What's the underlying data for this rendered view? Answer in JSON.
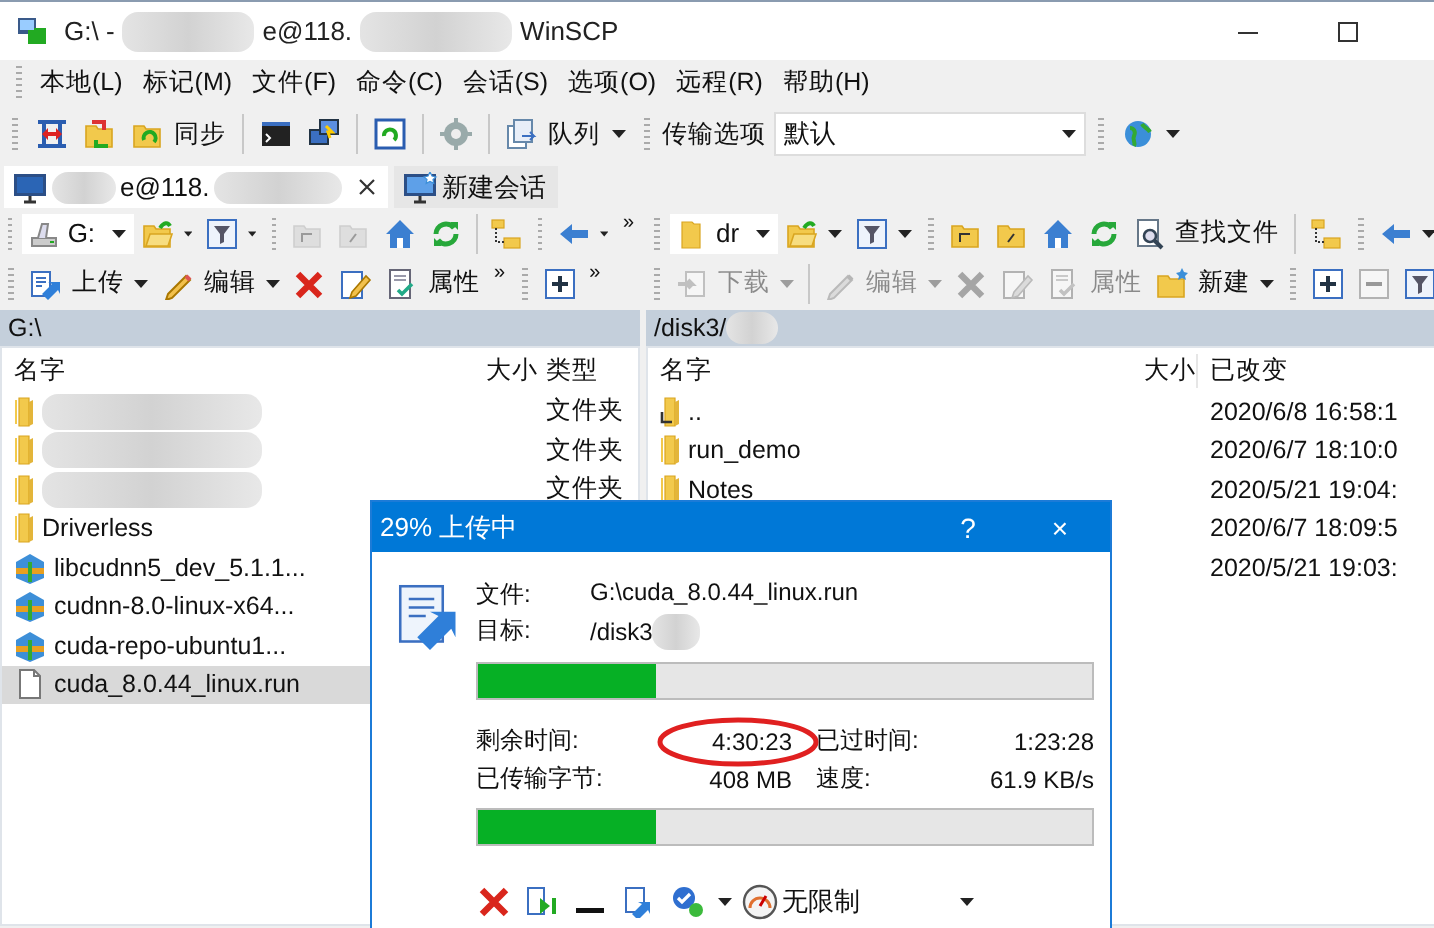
{
  "window": {
    "title_prefix": "G:\\ -",
    "title_host": "e@118.",
    "title_suffix": "WinSCP"
  },
  "menu": [
    {
      "label": "本地(L)"
    },
    {
      "label": "标记(M)"
    },
    {
      "label": "文件(F)"
    },
    {
      "label": "命令(C)"
    },
    {
      "label": "会话(S)"
    },
    {
      "label": "选项(O)"
    },
    {
      "label": "远程(R)"
    },
    {
      "label": "帮助(H)"
    }
  ],
  "main_toolbar": [
    {
      "kind": "grip"
    },
    {
      "kind": "compare"
    },
    {
      "kind": "sync-folders"
    },
    {
      "kind": "sync",
      "label": "同步"
    },
    {
      "kind": "sep"
    },
    {
      "kind": "terminal"
    },
    {
      "kind": "putty"
    },
    {
      "kind": "sep"
    },
    {
      "kind": "panel-refresh"
    },
    {
      "kind": "sep"
    },
    {
      "kind": "gear"
    },
    {
      "kind": "sep"
    },
    {
      "kind": "queue",
      "label": "队列",
      "dropdown": true
    },
    {
      "kind": "grip"
    },
    {
      "kind": "text",
      "label": "传输选项"
    },
    {
      "kind": "combo",
      "label": "默认"
    },
    {
      "kind": "grip"
    },
    {
      "kind": "globe",
      "dropdown": true
    }
  ],
  "session_tabs": [
    {
      "label": "e@118.",
      "selected": true
    },
    {
      "label": "新建会话",
      "selected": false
    }
  ],
  "panels": [
    {
      "toolbar_top": [
        {
          "kind": "grip"
        },
        {
          "kind": "drive-combo",
          "label": "G:"
        },
        {
          "kind": "folder-open",
          "dropdown": true
        },
        {
          "kind": "filter",
          "dropdown": true
        },
        {
          "kind": "grip"
        },
        {
          "kind": "parent-dir",
          "disabled": true
        },
        {
          "kind": "root-dir",
          "disabled": true
        },
        {
          "kind": "home"
        },
        {
          "kind": "refresh"
        },
        {
          "kind": "sep"
        },
        {
          "kind": "tree"
        },
        {
          "kind": "grip"
        },
        {
          "kind": "back",
          "dropdown": true
        },
        {
          "kind": "overflow",
          "label": "»"
        }
      ],
      "toolbar_bottom": [
        {
          "kind": "grip"
        },
        {
          "kind": "upload",
          "label": "上传",
          "dropdown": true,
          "disabled": false
        },
        {
          "kind": "edit",
          "label": "编辑",
          "dropdown": true,
          "disabled": false
        },
        {
          "kind": "delete",
          "disabled": false
        },
        {
          "kind": "rename",
          "disabled": false
        },
        {
          "kind": "properties",
          "label": "属性",
          "disabled": false
        },
        {
          "kind": "overflow",
          "label": "»"
        },
        {
          "kind": "grip"
        },
        {
          "kind": "plus",
          "disabled": false
        },
        {
          "kind": "overflow",
          "label": "»"
        }
      ],
      "path": "G:\\",
      "columns": [
        {
          "kind": "name",
          "label": "名字"
        },
        {
          "kind": "size",
          "label": "大小"
        },
        {
          "kind": "type",
          "label": "类型"
        }
      ],
      "rows": [
        {
          "kind": "folder",
          "blurred": true,
          "type": "文件夹",
          "selected": false
        },
        {
          "kind": "folder",
          "blurred": true,
          "type": "文件夹",
          "selected": false
        },
        {
          "kind": "folder",
          "blurred": true,
          "type": "文件夹",
          "selected": false
        },
        {
          "kind": "folder",
          "name": "Driverless",
          "selected": false
        },
        {
          "kind": "archive",
          "name": "libcudnn5_dev_5.1.1...",
          "selected": false
        },
        {
          "kind": "archive",
          "name": "cudnn-8.0-linux-x64...",
          "selected": false
        },
        {
          "kind": "archive",
          "name": "cuda-repo-ubuntu1...",
          "selected": false
        },
        {
          "kind": "file",
          "name": "cuda_8.0.44_linux.run",
          "selected": true
        }
      ]
    },
    {
      "toolbar_top": [
        {
          "kind": "grip"
        },
        {
          "kind": "folder-combo",
          "label": "dr"
        },
        {
          "kind": "folder-open",
          "dropdown": true
        },
        {
          "kind": "filter",
          "dropdown": true
        },
        {
          "kind": "grip"
        },
        {
          "kind": "parent-dir"
        },
        {
          "kind": "root-dir"
        },
        {
          "kind": "home"
        },
        {
          "kind": "refresh"
        },
        {
          "kind": "find",
          "label": "查找文件"
        },
        {
          "kind": "sep"
        },
        {
          "kind": "tree"
        },
        {
          "kind": "grip"
        },
        {
          "kind": "back",
          "dropdown": true
        }
      ],
      "toolbar_bottom": [
        {
          "kind": "grip"
        },
        {
          "kind": "download",
          "label": "下载",
          "dropdown": true,
          "disabled": true
        },
        {
          "kind": "sep"
        },
        {
          "kind": "edit",
          "label": "编辑",
          "dropdown": true,
          "disabled": true
        },
        {
          "kind": "delete",
          "disabled": true
        },
        {
          "kind": "rename",
          "disabled": true
        },
        {
          "kind": "properties",
          "label": "属性",
          "disabled": true
        },
        {
          "kind": "new-folder",
          "label": "新建",
          "dropdown": true,
          "disabled": false
        },
        {
          "kind": "grip"
        },
        {
          "kind": "plus",
          "disabled": false
        },
        {
          "kind": "minus",
          "disabled": true
        },
        {
          "kind": "filter",
          "disabled": false
        }
      ],
      "path": "/disk3/",
      "columns": [
        {
          "kind": "name",
          "label": "名字"
        },
        {
          "kind": "size",
          "label": "大小"
        },
        {
          "kind": "modified",
          "label": "已改变"
        }
      ],
      "rows": [
        {
          "kind": "parent",
          "name": "..",
          "modified": "2020/6/8 16:58:1",
          "selected": false
        },
        {
          "kind": "folder",
          "name": "run_demo",
          "modified": "2020/6/7 18:10:0",
          "selected": false
        },
        {
          "kind": "folder",
          "name": "Notes",
          "modified": "2020/5/21 19:04:",
          "selected": false
        },
        {
          "kind": "hidden",
          "modified": "2020/6/7 18:09:5",
          "selected": false
        },
        {
          "kind": "hidden",
          "modified": "2020/5/21 19:03:",
          "selected": false
        }
      ]
    }
  ],
  "dialog": {
    "title": "29% 上传中",
    "help": "?",
    "close": "×",
    "file_label": "文件:",
    "file": "G:\\cuda_8.0.44_linux.run",
    "target_label": "目标:",
    "target": "/disk3",
    "file_progress": {
      "level": 0.29
    },
    "stats": [
      {
        "label": "剩余时间:",
        "value": "4:30:23",
        "highlighted": true
      },
      {
        "label": "已过时间:",
        "value": "1:23:28",
        "highlighted": false
      },
      {
        "label": "已传输字节:",
        "value": "408 MB",
        "highlighted": false
      },
      {
        "label": "速度:",
        "value": "61.9 KB/s",
        "highlighted": false
      }
    ],
    "total_progress": {
      "level": 0.29
    },
    "speed_limit": "无限制"
  }
}
